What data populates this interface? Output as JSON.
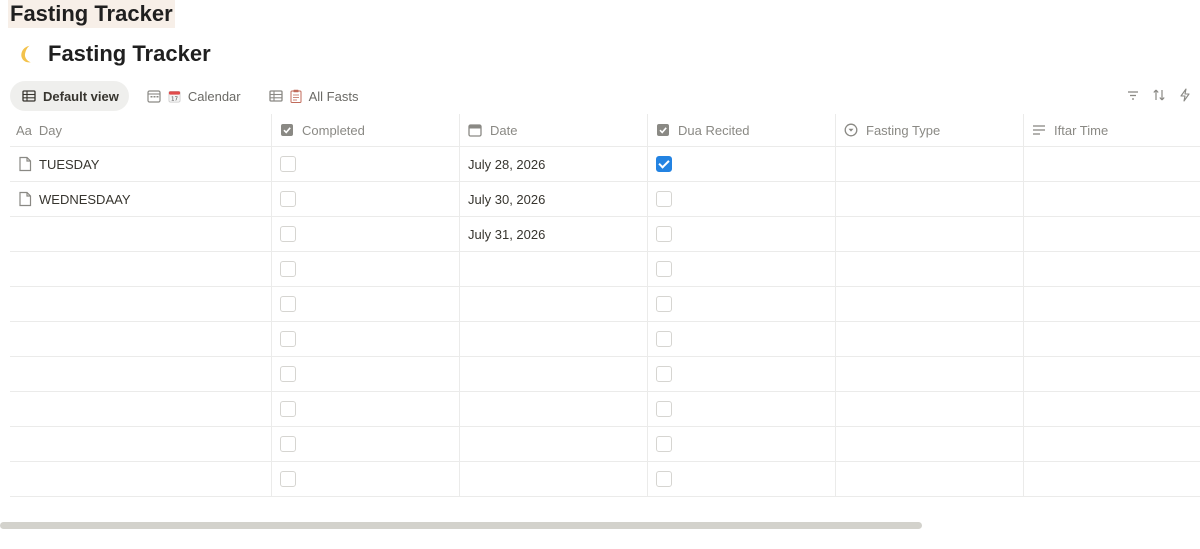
{
  "page": {
    "title": "Fasting Tracker"
  },
  "database": {
    "icon": "crescent-moon-icon",
    "title": "Fasting Tracker"
  },
  "views": [
    {
      "label": "Default view",
      "icon": "table-icon",
      "active": true
    },
    {
      "label": "Calendar",
      "icon": "calendar-icon",
      "emoji": "calendar-emoji-icon"
    },
    {
      "label": "All Fasts",
      "icon": "table-icon",
      "emoji": "clipboard-emoji-icon"
    }
  ],
  "toolbar": {
    "icons": [
      "filter-icon",
      "sort-icon",
      "automation-icon"
    ]
  },
  "columns": [
    {
      "label": "Day",
      "icon": "title-icon"
    },
    {
      "label": "Completed",
      "icon": "checkbox-icon"
    },
    {
      "label": "Date",
      "icon": "calendar-icon"
    },
    {
      "label": "Dua Recited",
      "icon": "checkbox-icon"
    },
    {
      "label": "Fasting Type",
      "icon": "select-icon"
    },
    {
      "label": "Iftar Time",
      "icon": "text-icon"
    }
  ],
  "rows": [
    {
      "day": "TUESDAY",
      "completed": false,
      "date": "July 28, 2026",
      "dua": true,
      "type": "",
      "iftar": ""
    },
    {
      "day": "WEDNESDAAY",
      "completed": false,
      "date": "July 30, 2026",
      "dua": false,
      "type": "",
      "iftar": ""
    },
    {
      "day": "",
      "completed": false,
      "date": "July 31, 2026",
      "dua": false,
      "type": "",
      "iftar": ""
    },
    {
      "day": "",
      "completed": false,
      "date": "",
      "dua": false,
      "type": "",
      "iftar": ""
    },
    {
      "day": "",
      "completed": false,
      "date": "",
      "dua": false,
      "type": "",
      "iftar": ""
    },
    {
      "day": "",
      "completed": false,
      "date": "",
      "dua": false,
      "type": "",
      "iftar": ""
    },
    {
      "day": "",
      "completed": false,
      "date": "",
      "dua": false,
      "type": "",
      "iftar": ""
    },
    {
      "day": "",
      "completed": false,
      "date": "",
      "dua": false,
      "type": "",
      "iftar": ""
    },
    {
      "day": "",
      "completed": false,
      "date": "",
      "dua": false,
      "type": "",
      "iftar": ""
    },
    {
      "day": "",
      "completed": false,
      "date": "",
      "dua": false,
      "type": "",
      "iftar": ""
    }
  ],
  "colors": {
    "accent": "#2383e2",
    "title_highlight": "#f7efe8"
  }
}
